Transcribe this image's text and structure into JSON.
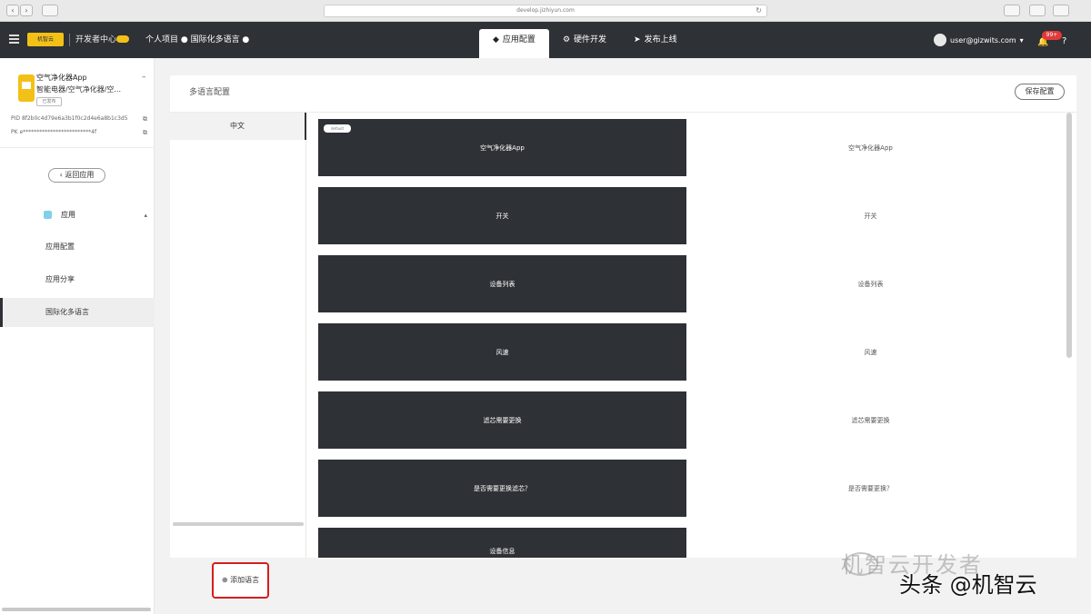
{
  "browser": {
    "url": "develop.jizhiyun.com",
    "back": "‹",
    "forward": "›",
    "reload": "↻"
  },
  "topnav": {
    "logo": "机智云",
    "devcenter": "开发者中心",
    "project": "个人项目 ● 国际化多语言 ●",
    "tabs": [
      {
        "label": "应用配置",
        "icon": "◆"
      },
      {
        "label": "硬件开发",
        "icon": "⚙"
      },
      {
        "label": "发布上线",
        "icon": "➤"
      }
    ],
    "user_email": "user@gizwits.com",
    "user_caret": "▾",
    "badge": "99+",
    "bell": "🔔",
    "help": "?"
  },
  "sidebar": {
    "product_name": "空气净化器App",
    "product_sub": "智能电器/空气净化器/空...",
    "product_tag": "已发布",
    "minus": "–",
    "rows": [
      {
        "label": "PID",
        "value": "8f2b0c4d79e6a3b1f0c2d4e6a8b1c3d5"
      },
      {
        "label": "PK",
        "value": "e*************************4f"
      }
    ],
    "back_label": "‹ 返回应用",
    "nav_parent": "应用",
    "nav_caret": "▴",
    "items": [
      {
        "label": "应用配置"
      },
      {
        "label": "应用分享"
      },
      {
        "label": "国际化多语言"
      }
    ]
  },
  "main": {
    "title": "多语言配置",
    "save_label": "保存配置",
    "languages": [
      {
        "label": "中文"
      }
    ],
    "add_lang_label": "⊕ 添加语言",
    "tag": "default",
    "rows": [
      {
        "key": "空气净化器App",
        "value": "空气净化器App"
      },
      {
        "key": "开关",
        "value": "开关"
      },
      {
        "key": "设备列表",
        "value": "设备列表"
      },
      {
        "key": "风速",
        "value": "风速"
      },
      {
        "key": "滤芯需要更换",
        "value": "滤芯需要更换"
      },
      {
        "key": "是否需要更换滤芯？",
        "value": "是否需要更换？"
      },
      {
        "key": "设备信息",
        "value": ""
      }
    ]
  },
  "watermark": {
    "text": "机智云开发者",
    "source": "头条 @机智云"
  }
}
